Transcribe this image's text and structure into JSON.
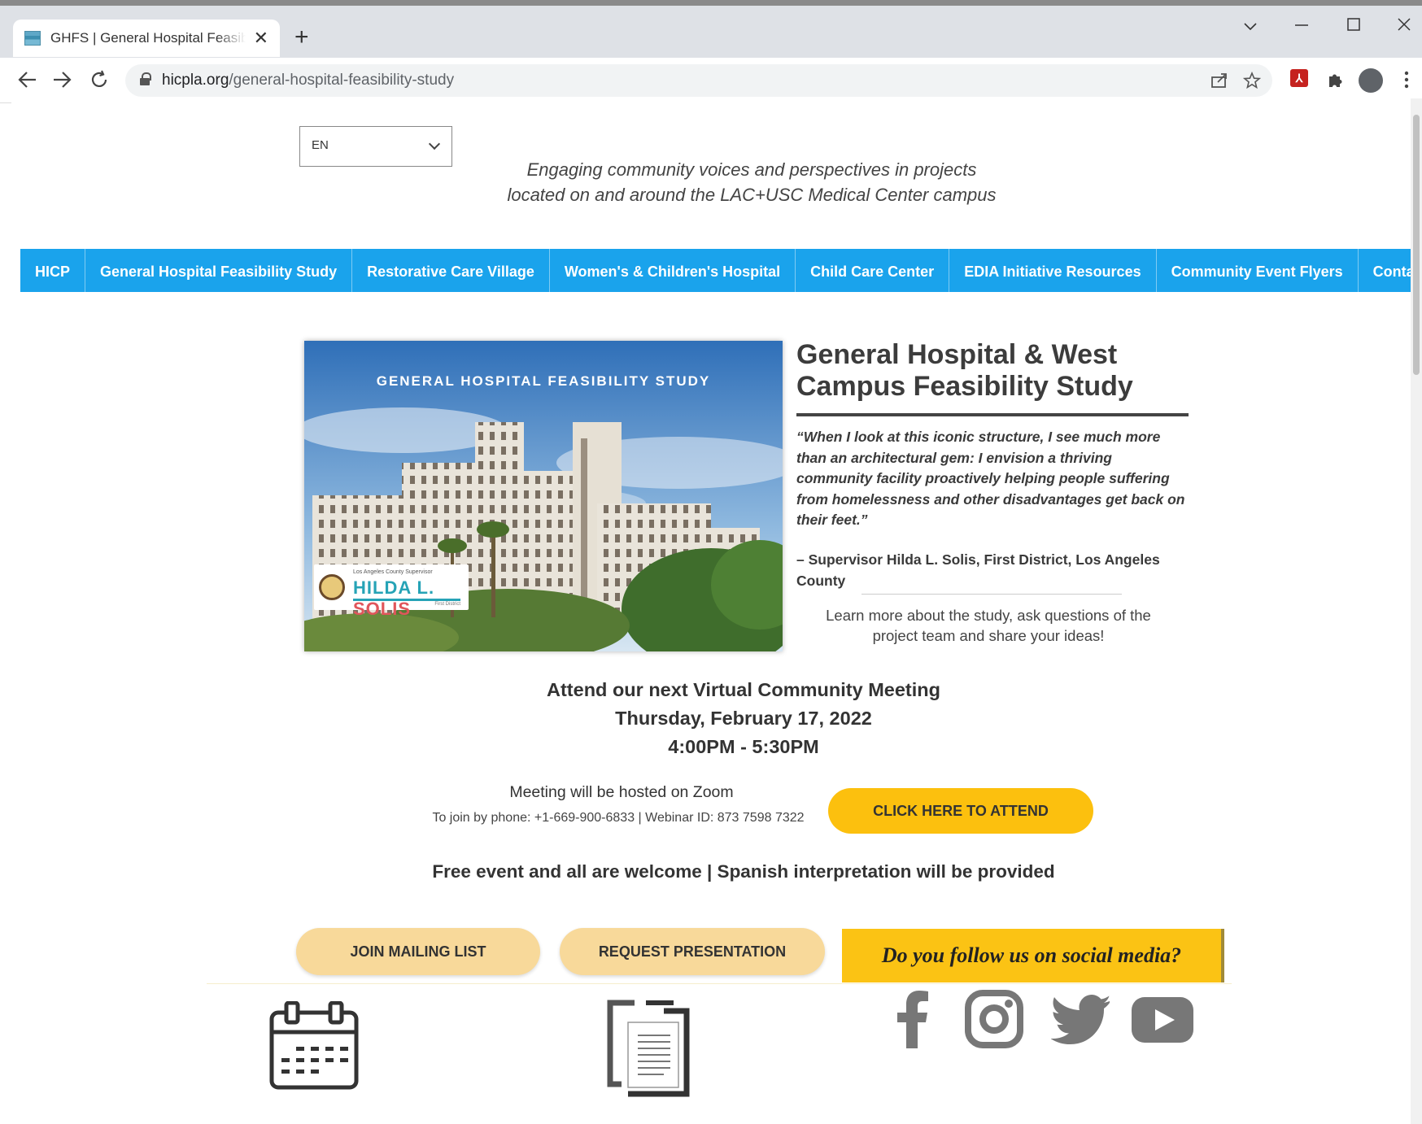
{
  "browser": {
    "tab_title": "GHFS | General Hospital Feasibility Study",
    "url_host": "hicpla.org",
    "url_path": "/general-hospital-feasibility-study",
    "new_tab_glyph": "+",
    "close_glyph": "✕"
  },
  "language": {
    "selected": "EN"
  },
  "tagline": {
    "line1": "Engaging community voices and perspectives in projects",
    "line2": "located on and around the LAC+USC Medical Center campus"
  },
  "nav": {
    "items": [
      "HICP",
      "General Hospital Feasibility Study",
      "Restorative Care Village",
      "Women's & Children's Hospital",
      "Child Care Center",
      "EDIA Initiative Resources",
      "Community Event Flyers",
      "Contact"
    ]
  },
  "hero": {
    "banner": "GENERAL HOSPITAL FEASIBILITY STUDY",
    "badge_small": "Los Angeles County Supervisor",
    "badge_first": "HILDA L.",
    "badge_last": "SOLIS",
    "badge_district": "First District"
  },
  "study": {
    "title": "General Hospital & West Campus Feasibility Study",
    "quote": "“When I look at this iconic structure, I see much more than an architectural gem: I envision a thriving community facility proactively helping people suffering from homelessness and other disadvantages get back on their feet.”",
    "attribution": "– Supervisor Hilda L. Solis, First District, Los Angeles County",
    "learn_more": "Learn more about the study, ask questions of the project team and share your ideas!"
  },
  "meeting": {
    "heading": "Attend our next Virtual Community Meeting",
    "date": "Thursday, February 17, 2022",
    "time": "4:00PM - 5:30PM",
    "host": "Meeting will be hosted on Zoom",
    "phone": "To join by phone: +1-669-900-6833 | Webinar ID: 873 7598 7322",
    "attend_label": "CLICK HERE TO ATTEND",
    "free_event": "Free event and all are welcome | Spanish interpretation will be provided"
  },
  "actions": {
    "mailing_list": "JOIN MAILING LIST",
    "request_presentation": "REQUEST PRESENTATION",
    "social_prompt": "Do you follow us on social media?"
  },
  "colors": {
    "nav_blue": "#1aa3ec",
    "attend_yellow": "#fcc00e",
    "pill_tan": "#f8d99a",
    "social_yellow": "#fbc314"
  },
  "icons": [
    "calendar-icon",
    "document-icon",
    "facebook-icon",
    "instagram-icon",
    "twitter-icon",
    "youtube-icon"
  ]
}
